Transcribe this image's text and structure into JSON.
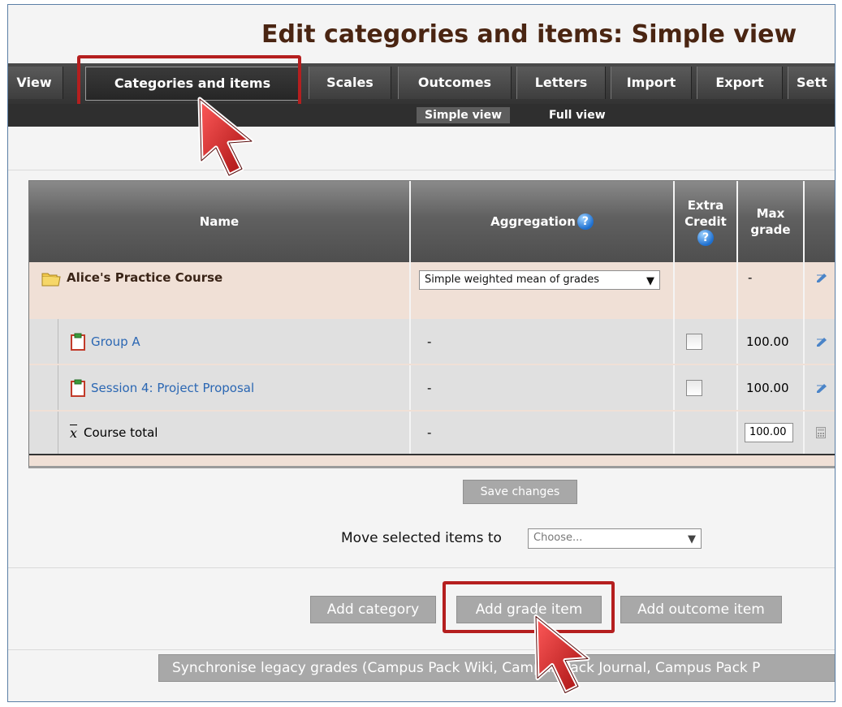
{
  "page_title": "Edit categories and items: Simple view",
  "tabs": [
    {
      "label": "View"
    },
    {
      "label": "Categories and items"
    },
    {
      "label": "Scales"
    },
    {
      "label": "Outcomes"
    },
    {
      "label": "Letters"
    },
    {
      "label": "Import"
    },
    {
      "label": "Export"
    },
    {
      "label": "Sett"
    }
  ],
  "subtabs": [
    {
      "label": "Simple view"
    },
    {
      "label": "Full view"
    }
  ],
  "table": {
    "headers": {
      "name": "Name",
      "aggregation": "Aggregation",
      "extra_credit_line1": "Extra",
      "extra_credit_line2": "Credit",
      "max_grade_line1": "Max",
      "max_grade_line2": "grade"
    },
    "rows": [
      {
        "name": "Alice's Practice Course",
        "aggregation": "Simple weighted mean of grades",
        "max_grade": "-"
      },
      {
        "name": "Group A",
        "aggregation": "-",
        "max_grade": "100.00"
      },
      {
        "name": "Session 4: Project Proposal",
        "aggregation": "-",
        "max_grade": "100.00"
      },
      {
        "name": "Course total",
        "aggregation": "-",
        "max_grade": "100.00"
      }
    ]
  },
  "actions": {
    "save_changes": "Save changes",
    "move_label": "Move selected items to",
    "move_select": "Choose...",
    "add_category": "Add category",
    "add_grade_item": "Add grade item",
    "add_outcome_item": "Add outcome item",
    "synchronise": "Synchronise legacy grades (Campus Pack Wiki, Campus Pack Journal, Campus Pack P"
  },
  "icons": {
    "folder": "folder-icon",
    "grade_item": "clipboard-icon",
    "course_total": "x-bar-icon",
    "help": "help-icon",
    "edit": "edit-icon",
    "calculator": "calculator-icon"
  },
  "colors": {
    "title": "#4a2512",
    "highlight": "#b51f1f",
    "link": "#2b67b3",
    "category_row": "#f0e0d6"
  }
}
